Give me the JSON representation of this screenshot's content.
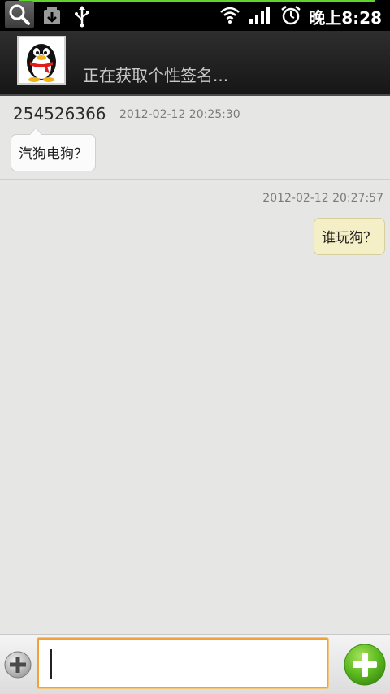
{
  "status_bar": {
    "time": "晚上8:28",
    "icons": [
      "search-icon",
      "download-icon",
      "usb-icon",
      "wifi-icon",
      "signal-icon",
      "alarm-icon"
    ]
  },
  "header": {
    "signature": "正在获取个性签名..."
  },
  "messages": [
    {
      "direction": "incoming",
      "sender": "254526366",
      "timestamp": "2012-02-12 20:25:30",
      "text": "汽狗电狗？"
    },
    {
      "direction": "outgoing",
      "sender": "",
      "timestamp": "2012-02-12 20:27:57",
      "text": "谁玩狗？"
    }
  ],
  "input": {
    "value": "",
    "placeholder": ""
  },
  "colors": {
    "accent_orange": "#f0a13a",
    "send_green": "#5bb81f",
    "outgoing_bubble": "#f4efc6",
    "incoming_bubble": "#fbfbfb",
    "background": "#e6e6e4"
  }
}
